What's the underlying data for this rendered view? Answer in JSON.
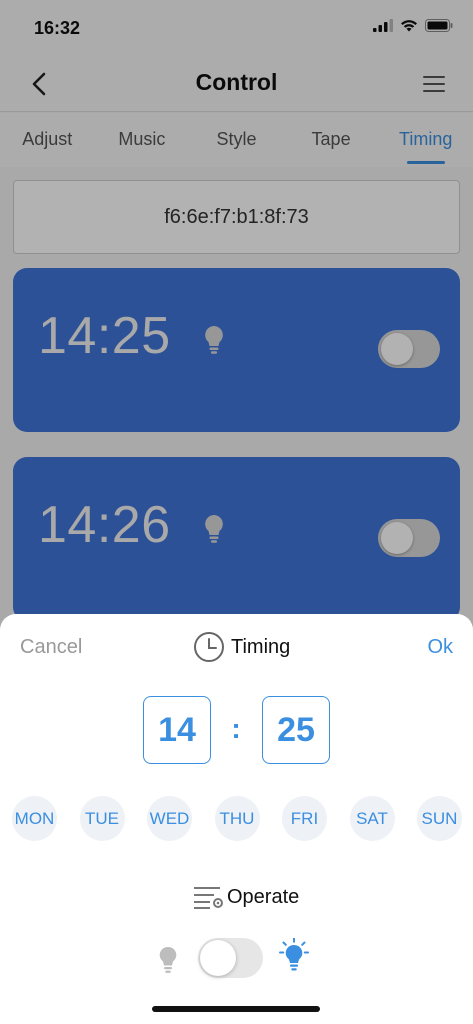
{
  "status": {
    "time": "16:32"
  },
  "nav": {
    "title": "Control"
  },
  "tabs": [
    {
      "label": "Adjust"
    },
    {
      "label": "Music"
    },
    {
      "label": "Style"
    },
    {
      "label": "Tape"
    },
    {
      "label": "Timing",
      "active": true
    }
  ],
  "device": {
    "mac": "f6:6e:f7:b1:8f:73"
  },
  "timers": [
    {
      "time": "14:25",
      "enabled": false
    },
    {
      "time": "14:26",
      "enabled": false
    }
  ],
  "sheet": {
    "cancel_label": "Cancel",
    "title": "Timing",
    "ok_label": "Ok",
    "hour": "14",
    "separator": ":",
    "minute": "25",
    "days": [
      "MON",
      "TUE",
      "WED",
      "THU",
      "FRI",
      "SAT",
      "SUN"
    ],
    "operate_label": "Operate",
    "operate_on": false
  },
  "colors": {
    "accent": "#3b8fe0",
    "card": "#3f74d8",
    "day_bg": "#eef1f6"
  },
  "icons": {
    "back": "chevron-left-icon",
    "menu": "hamburger-menu-icon",
    "bulb": "light-bulb-icon",
    "clock": "clock-icon",
    "operate": "list-settings-icon"
  }
}
